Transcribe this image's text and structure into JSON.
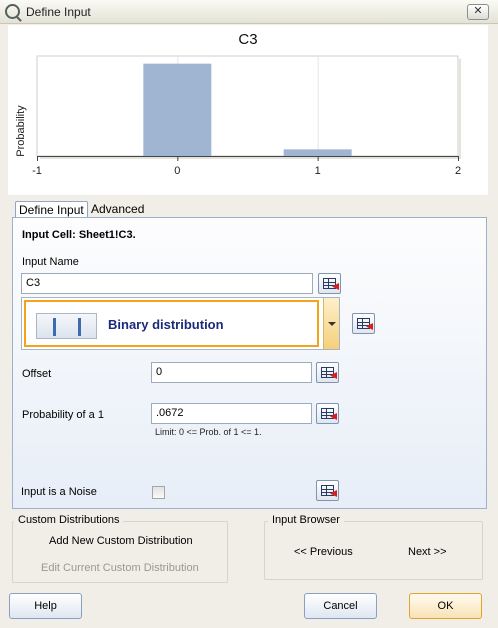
{
  "window": {
    "title": "Define Input",
    "close_label": "✕"
  },
  "chart_data": {
    "type": "bar",
    "title": "C3",
    "ylabel": "Probability",
    "xlabel": "",
    "x": [
      0,
      1
    ],
    "values": [
      0.9328,
      0.0672
    ],
    "xlim": [
      -1,
      2
    ],
    "xticks": [
      "-1",
      "0",
      "1",
      "2"
    ],
    "grid": true,
    "bar_color": "#9fb5d2"
  },
  "tabs": [
    {
      "label": "Define Input",
      "active": true
    },
    {
      "label": "Advanced",
      "active": false
    }
  ],
  "form": {
    "input_cell": "Input Cell: Sheet1!C3.",
    "input_name_label": "Input Name",
    "input_name_value": "C3",
    "distribution": "Binary distribution",
    "offset_label": "Offset",
    "offset_value": "0",
    "prob_label": "Probability of a 1",
    "prob_value": ".0672",
    "prob_limit": "Limit: 0 <=  Prob. of 1 <= 1.",
    "noise_label": "Input is a Noise",
    "noise_checked": false
  },
  "custom": {
    "title": "Custom Distributions",
    "add": "Add New Custom Distribution",
    "edit": "Edit Current Custom Distribution"
  },
  "browser": {
    "title": "Input Browser",
    "previous": "<< Previous",
    "next": "Next >>"
  },
  "buttons": {
    "help": "Help",
    "cancel": "Cancel",
    "ok": "OK"
  }
}
